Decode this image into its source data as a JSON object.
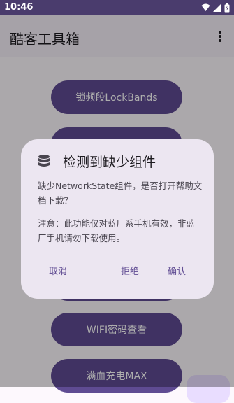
{
  "status_bar": {
    "time": "10:46"
  },
  "app": {
    "title": "酷客工具箱"
  },
  "buttons": {
    "lockbands": "锁频段LockBands",
    "wifi_password": "WIFI密码查看",
    "full_charge": "满血充电MAX"
  },
  "dialog": {
    "title": "检测到缺少组件",
    "message1": "缺少NetworkState组件，是否打开帮助文档下载？",
    "message2": "注意：此功能仅对蓝厂系手机有效，非蓝厂手机请勿下载使用。",
    "cancel": "取消",
    "reject": "拒绝",
    "confirm": "确认"
  },
  "colors": {
    "primary": "#5f4b92",
    "status_bar": "#4a3c6d",
    "dialog_bg": "#ece6f1",
    "fab_bg": "#e9ddff"
  }
}
